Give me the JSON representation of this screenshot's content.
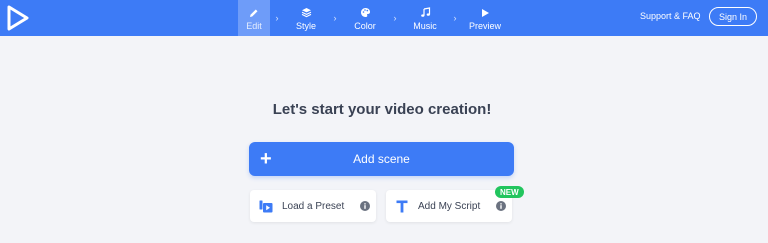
{
  "header": {
    "logo_icon": "play-logo-icon",
    "steps": [
      {
        "label": "Edit",
        "icon": "pencil-icon",
        "active": true
      },
      {
        "label": "Style",
        "icon": "layers-icon",
        "active": false
      },
      {
        "label": "Color",
        "icon": "palette-icon",
        "active": false
      },
      {
        "label": "Music",
        "icon": "music-note-icon",
        "active": false
      },
      {
        "label": "Preview",
        "icon": "play-icon",
        "active": false
      }
    ],
    "step_separator": "›",
    "support_label": "Support & FAQ",
    "signin_label": "Sign In"
  },
  "main": {
    "headline": "Let's start your video creation!",
    "add_scene": {
      "plus": "+",
      "label": "Add scene"
    },
    "preset": {
      "label": "Load a Preset",
      "icon": "preset-icon"
    },
    "script": {
      "label": "Add My Script",
      "icon": "text-t-icon",
      "badge": "NEW"
    }
  },
  "colors": {
    "accent": "#3d7bf6",
    "active_step": "#6e9cf9",
    "background": "#f3f4f8",
    "badge": "#22c55e",
    "text_dark": "#3a4254"
  }
}
